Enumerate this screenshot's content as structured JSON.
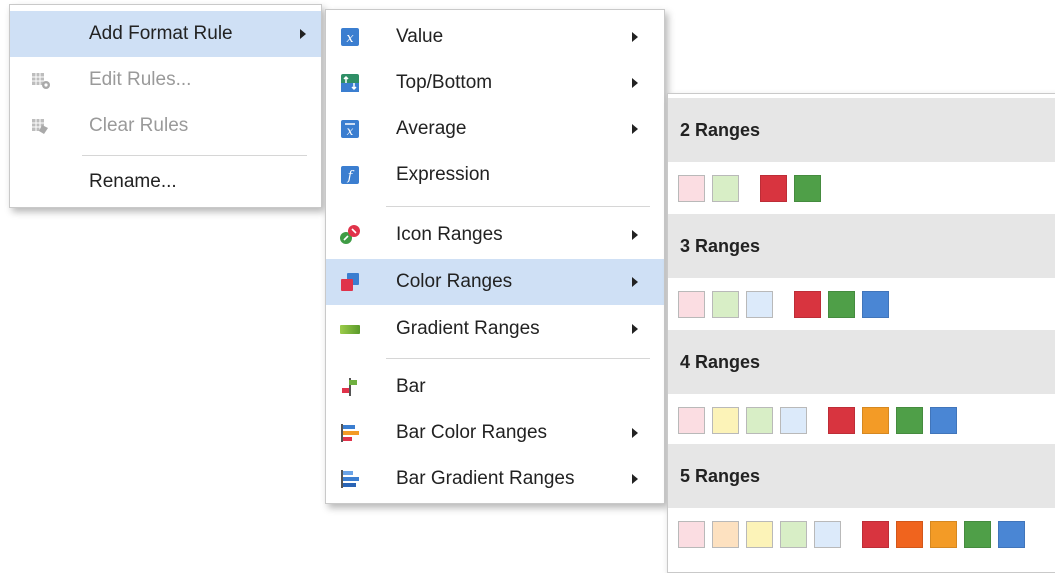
{
  "context_menu": {
    "items": [
      {
        "label": "Add Format Rule",
        "icon": "none",
        "disabled": false,
        "submenu": true,
        "highlighted": true
      },
      {
        "label": "Edit Rules...",
        "icon": "edit-rules-icon",
        "disabled": true,
        "submenu": false
      },
      {
        "label": "Clear Rules",
        "icon": "clear-rules-icon",
        "disabled": true,
        "submenu": false
      },
      {
        "label": "Rename...",
        "icon": "none",
        "disabled": false,
        "submenu": false
      }
    ]
  },
  "format_rule_menu": {
    "items": [
      {
        "label": "Value",
        "icon": "value-icon",
        "submenu": true
      },
      {
        "label": "Top/Bottom",
        "icon": "top-bottom-icon",
        "submenu": true
      },
      {
        "label": "Average",
        "icon": "average-icon",
        "submenu": true
      },
      {
        "label": "Expression",
        "icon": "expression-icon",
        "submenu": false
      },
      {
        "label": "Icon Ranges",
        "icon": "icon-ranges-icon",
        "submenu": true
      },
      {
        "label": "Color Ranges",
        "icon": "color-ranges-icon",
        "submenu": true,
        "highlighted": true
      },
      {
        "label": "Gradient Ranges",
        "icon": "gradient-ranges-icon",
        "submenu": true
      },
      {
        "label": "Bar",
        "icon": "bar-icon",
        "submenu": false
      },
      {
        "label": "Bar Color Ranges",
        "icon": "bar-color-ranges-icon",
        "submenu": true
      },
      {
        "label": "Bar Gradient Ranges",
        "icon": "bar-gradient-ranges-icon",
        "submenu": true
      }
    ]
  },
  "color_ranges_gallery": {
    "groups": [
      {
        "title": "2 Ranges",
        "light": [
          "#fbdde2",
          "#d8eec6"
        ],
        "dark": [
          "#d8343f",
          "#4f9f48"
        ]
      },
      {
        "title": "3 Ranges",
        "light": [
          "#fbdde2",
          "#d8eec6",
          "#dceafa"
        ],
        "dark": [
          "#d8343f",
          "#4f9f48",
          "#4a86d4"
        ]
      },
      {
        "title": "4 Ranges",
        "light": [
          "#fbdde2",
          "#fcf3b8",
          "#d8eec6",
          "#dceafa"
        ],
        "dark": [
          "#d8343f",
          "#f39b26",
          "#4f9f48",
          "#4a86d4"
        ]
      },
      {
        "title": "5 Ranges",
        "light": [
          "#fbdde2",
          "#fde1c0",
          "#fcf3b8",
          "#d8eec6",
          "#dceafa"
        ],
        "dark": [
          "#d8343f",
          "#f0641e",
          "#f39b26",
          "#4f9f48",
          "#4a86d4"
        ]
      }
    ]
  },
  "colors": {
    "highlight": "#cfe0f5",
    "group_header_bg": "#e6e6e6",
    "disabled_text": "#9a9a9a"
  }
}
